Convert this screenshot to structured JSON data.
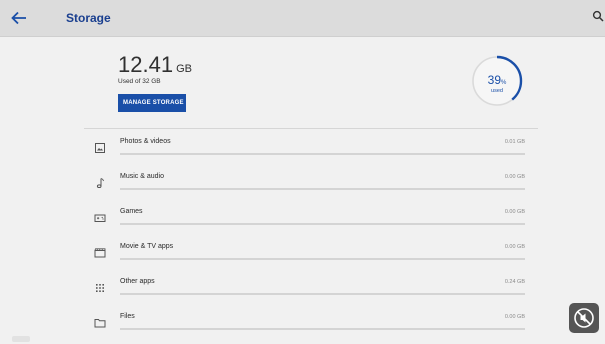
{
  "header": {
    "title": "Storage"
  },
  "summary": {
    "used_value": "12.41",
    "used_unit": "GB",
    "used_of": "Used of 32 GB",
    "manage_label": "MANAGE STORAGE",
    "percent_number": "39",
    "percent_sign": "%",
    "percent_label": "used",
    "percent_used": 0.39
  },
  "categories": [
    {
      "label": "Photos & videos",
      "size": "0.01 GB",
      "icon": "photo-icon",
      "fraction": 0.0
    },
    {
      "label": "Music & audio",
      "size": "0.00 GB",
      "icon": "music-note-icon",
      "fraction": 0.0
    },
    {
      "label": "Games",
      "size": "0.00 GB",
      "icon": "gamepad-icon",
      "fraction": 0.0
    },
    {
      "label": "Movie & TV apps",
      "size": "0.00 GB",
      "icon": "clapperboard-icon",
      "fraction": 0.0
    },
    {
      "label": "Other apps",
      "size": "0.24 GB",
      "icon": "apps-grid-icon",
      "fraction": 0.0
    },
    {
      "label": "Files",
      "size": "0.00 GB",
      "icon": "folder-icon",
      "fraction": 0.0
    }
  ],
  "colors": {
    "accent": "#1a4fa8",
    "header_bg": "#dcdcdc",
    "page_bg": "#f1f1f1"
  }
}
